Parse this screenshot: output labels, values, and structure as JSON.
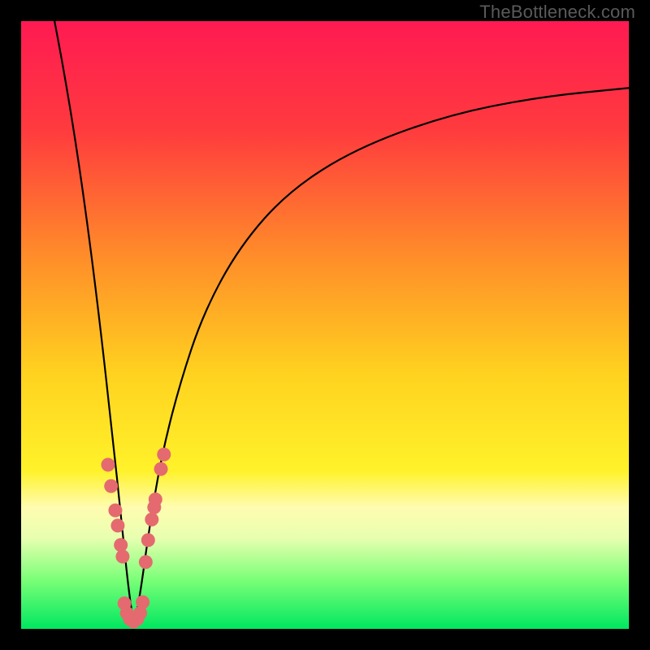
{
  "watermark": {
    "text": "TheBottleneck.com"
  },
  "chart_data": {
    "type": "line",
    "title": "",
    "xlabel": "",
    "ylabel": "",
    "xlim": [
      0,
      100
    ],
    "ylim": [
      0,
      100
    ],
    "grid": false,
    "legend": false,
    "gradient_stops": [
      {
        "pct": 0,
        "color": "#ff1a52"
      },
      {
        "pct": 18,
        "color": "#ff3b3e"
      },
      {
        "pct": 38,
        "color": "#ff8a2a"
      },
      {
        "pct": 58,
        "color": "#ffd21f"
      },
      {
        "pct": 74,
        "color": "#fff22a"
      },
      {
        "pct": 80,
        "color": "#fffcb0"
      },
      {
        "pct": 85,
        "color": "#e8ffb0"
      },
      {
        "pct": 92,
        "color": "#79ff77"
      },
      {
        "pct": 100,
        "color": "#00e760"
      }
    ],
    "curve_minimum_x": 18.5,
    "curve_points": [
      {
        "x": 5.5,
        "y": 100
      },
      {
        "x": 7,
        "y": 92
      },
      {
        "x": 9,
        "y": 80
      },
      {
        "x": 11,
        "y": 66
      },
      {
        "x": 13,
        "y": 50
      },
      {
        "x": 15,
        "y": 32
      },
      {
        "x": 16.5,
        "y": 18
      },
      {
        "x": 17.5,
        "y": 8
      },
      {
        "x": 18.5,
        "y": 0.6
      },
      {
        "x": 19.5,
        "y": 5
      },
      {
        "x": 21,
        "y": 16
      },
      {
        "x": 23,
        "y": 28
      },
      {
        "x": 26,
        "y": 40
      },
      {
        "x": 30,
        "y": 52
      },
      {
        "x": 36,
        "y": 63
      },
      {
        "x": 44,
        "y": 72
      },
      {
        "x": 55,
        "y": 79
      },
      {
        "x": 70,
        "y": 84.5
      },
      {
        "x": 85,
        "y": 87.5
      },
      {
        "x": 100,
        "y": 89
      }
    ],
    "marker_points": [
      {
        "x": 14.3,
        "y": 27
      },
      {
        "x": 14.8,
        "y": 23.5
      },
      {
        "x": 15.5,
        "y": 19.5
      },
      {
        "x": 15.9,
        "y": 17
      },
      {
        "x": 16.4,
        "y": 13.8
      },
      {
        "x": 16.7,
        "y": 11.9
      },
      {
        "x": 17.0,
        "y": 4.2
      },
      {
        "x": 17.4,
        "y": 2.6
      },
      {
        "x": 17.9,
        "y": 1.6
      },
      {
        "x": 18.5,
        "y": 1.2
      },
      {
        "x": 19.1,
        "y": 1.6
      },
      {
        "x": 19.6,
        "y": 2.6
      },
      {
        "x": 20.0,
        "y": 4.4
      },
      {
        "x": 20.5,
        "y": 11.0
      },
      {
        "x": 20.9,
        "y": 14.6
      },
      {
        "x": 21.5,
        "y": 18.0
      },
      {
        "x": 21.9,
        "y": 20.0
      },
      {
        "x": 22.1,
        "y": 21.3
      },
      {
        "x": 23.0,
        "y": 26.3
      },
      {
        "x": 23.5,
        "y": 28.7
      }
    ],
    "marker_color": "#e46a6f",
    "curve_color": "#000000",
    "curve_width": 2.2
  }
}
